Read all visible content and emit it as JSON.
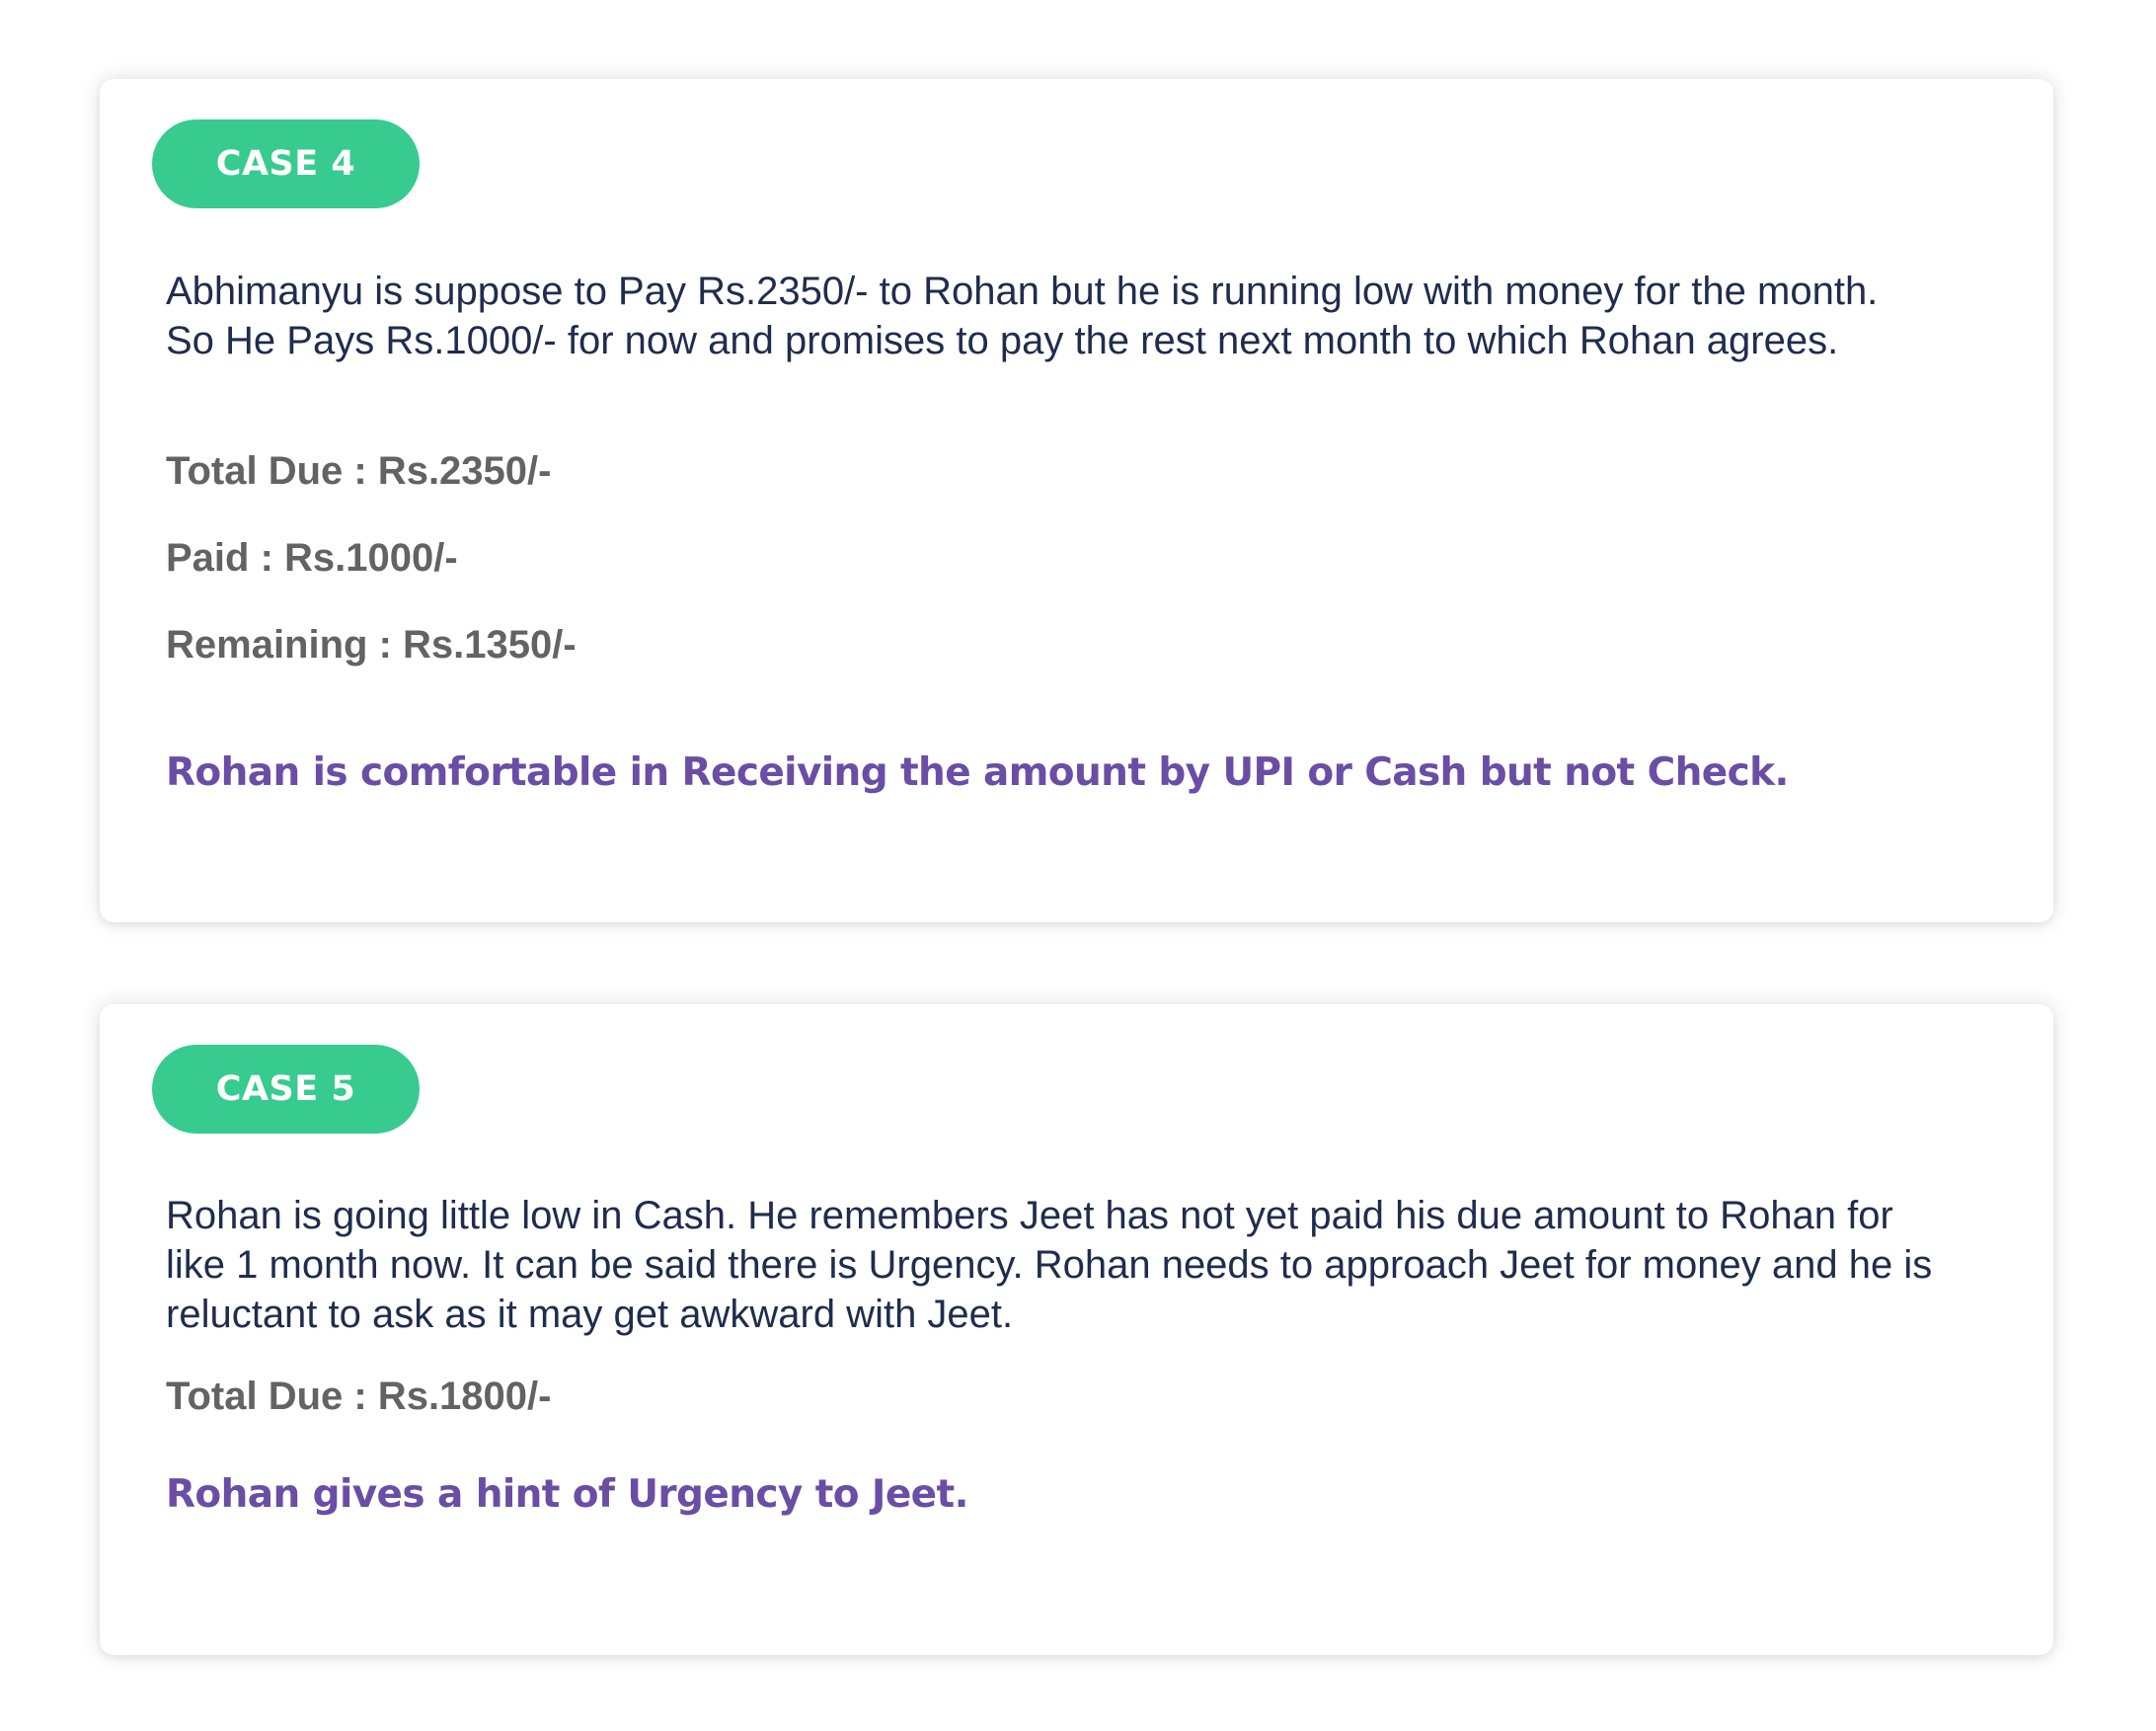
{
  "cases": [
    {
      "badge": "CASE 4",
      "description_lines": [
        "Abhimanyu is suppose to Pay Rs.2350/- to Rohan but he is running low with money for the month.",
        "So He Pays Rs.1000/- for now and promises to pay the rest next month to which Rohan agrees."
      ],
      "facts": [
        "Total Due : Rs.2350/-",
        "Paid : Rs.1000/-",
        "Remaining : Rs.1350/-"
      ],
      "note": "Rohan is comfortable in Receiving the amount by UPI or Cash but not Check."
    },
    {
      "badge": "CASE 5",
      "description_lines": [
        "Rohan is going little low in Cash. He remembers Jeet has not yet paid his due amount to Rohan for",
        "like 1 month now. It can be said there is Urgency. Rohan needs to approach Jeet for money and he is",
        "reluctant to ask as it may get awkward with Jeet."
      ],
      "facts": [
        "Total Due : Rs.1800/-"
      ],
      "note": "Rohan gives a hint of Urgency to Jeet."
    }
  ],
  "colors": {
    "badge": "#38cb8f",
    "description_text": "#1f2d4d",
    "fact_text": "#636363",
    "note_text": "#6a4ea5"
  }
}
